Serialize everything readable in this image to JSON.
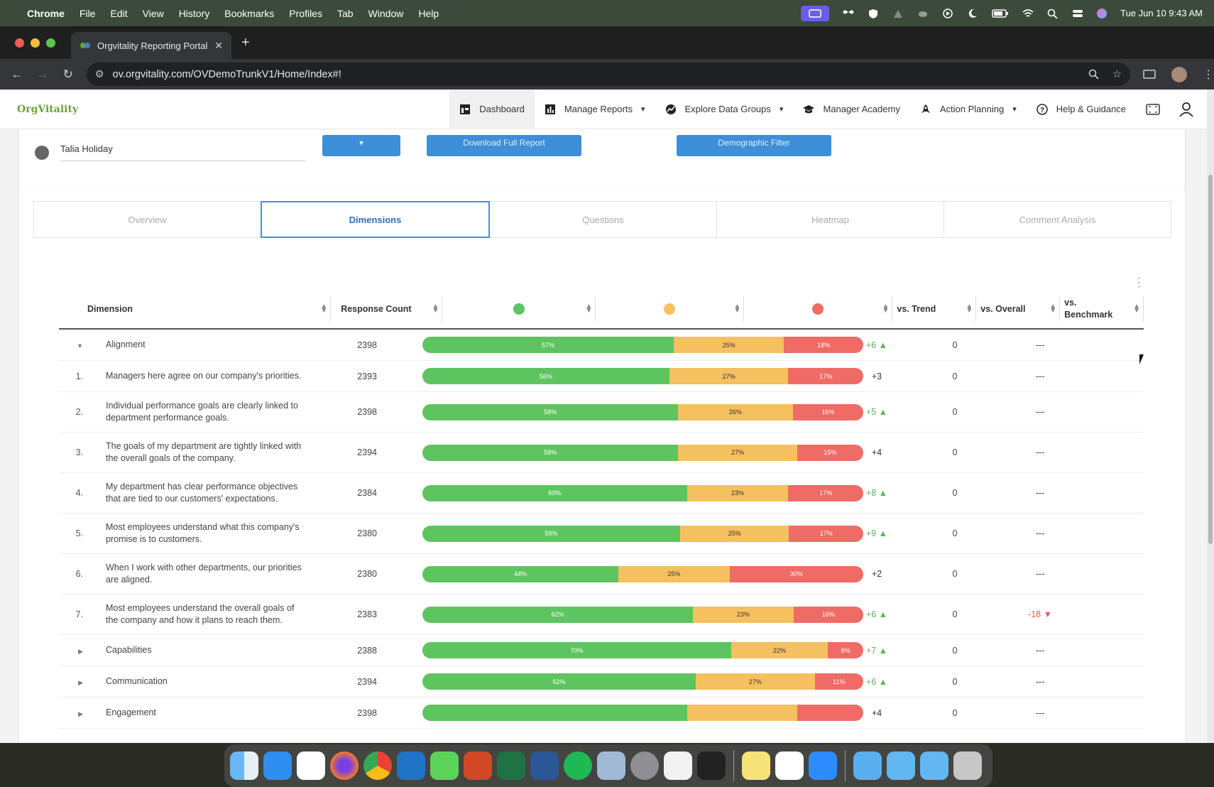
{
  "menubar": {
    "app": "Chrome",
    "items": [
      "File",
      "Edit",
      "View",
      "History",
      "Bookmarks",
      "Profiles",
      "Tab",
      "Window",
      "Help"
    ],
    "datetime": "Tue Jun 10  9:43 AM"
  },
  "browser": {
    "tab_title": "Orgvitality Reporting Portal",
    "url": "ov.orgvitality.com/OVDemoTrunkV1/Home/Index#!"
  },
  "app": {
    "logo_prefix": "Org",
    "logo_suffix": "Vitality",
    "nav": [
      {
        "label": "Dashboard",
        "icon": "dashboard-icon"
      },
      {
        "label": "Manage Reports",
        "icon": "bar-chart-icon"
      },
      {
        "label": "Explore Data Groups",
        "icon": "explore-chart-icon"
      },
      {
        "label": "Manager Academy",
        "icon": "graduation-cap-icon"
      },
      {
        "label": "Action Planning",
        "icon": "rocket-icon"
      },
      {
        "label": "Help & Guidance",
        "icon": "help-circle-icon"
      }
    ]
  },
  "filters": {
    "user_name": "Talia Holiday",
    "download_label": "Download Full Report",
    "demographic_label": "Demographic Filter"
  },
  "tabs": [
    "Overview",
    "Dimensions",
    "Questions",
    "Heatmap",
    "Comment Analysis"
  ],
  "active_tab": "Dimensions",
  "table": {
    "headers": {
      "dimension": "Dimension",
      "response_count": "Response Count",
      "favorable_color": "#5ec460",
      "neutral_color": "#f5c05f",
      "unfavorable_color": "#ee6b66",
      "vs_trend": "vs. Trend",
      "vs_overall": "vs. Overall",
      "vs_benchmark": "vs. Benchmark"
    },
    "rows": [
      {
        "type": "group",
        "expanded": true,
        "index": "",
        "label": "Alignment",
        "count": "2398",
        "fav": 57,
        "neu": 25,
        "unf": 18,
        "fav_label": "57%",
        "neu_label": "25%",
        "unf_label": "18%",
        "trend": "+6 ▲",
        "trend_class": "pos",
        "overall": "0",
        "bench": "---",
        "bench_class": "neu"
      },
      {
        "type": "item",
        "index": "1.",
        "label": "Managers here agree on our company's priorities.",
        "count": "2393",
        "fav": 56,
        "neu": 27,
        "unf": 17,
        "fav_label": "56%",
        "neu_label": "27%",
        "unf_label": "17%",
        "trend": "+3",
        "trend_class": "neu",
        "overall": "0",
        "bench": "---",
        "bench_class": "neu"
      },
      {
        "type": "item",
        "index": "2.",
        "label": "Individual performance goals are clearly linked to department performance goals.",
        "count": "2398",
        "fav": 58,
        "neu": 26,
        "unf": 16,
        "fav_label": "58%",
        "neu_label": "26%",
        "unf_label": "16%",
        "trend": "+5 ▲",
        "trend_class": "pos",
        "overall": "0",
        "bench": "---",
        "bench_class": "neu"
      },
      {
        "type": "item",
        "index": "3.",
        "label": "The goals of my department are tightly linked with the overall goals of the company.",
        "count": "2394",
        "fav": 58,
        "neu": 27,
        "unf": 15,
        "fav_label": "58%",
        "neu_label": "27%",
        "unf_label": "15%",
        "trend": "+4",
        "trend_class": "neu",
        "overall": "0",
        "bench": "---",
        "bench_class": "neu"
      },
      {
        "type": "item",
        "index": "4.",
        "label": "My department has clear performance objectives that are tied to our customers' expectations.",
        "count": "2384",
        "fav": 60,
        "neu": 23,
        "unf": 17,
        "fav_label": "60%",
        "neu_label": "23%",
        "unf_label": "17%",
        "trend": "+8 ▲",
        "trend_class": "pos",
        "overall": "0",
        "bench": "---",
        "bench_class": "neu"
      },
      {
        "type": "item",
        "index": "5.",
        "label": "Most employees understand what this company's promise is to customers.",
        "count": "2380",
        "fav": 59,
        "neu": 25,
        "unf": 17,
        "fav_label": "59%",
        "neu_label": "25%",
        "unf_label": "17%",
        "trend": "+9 ▲",
        "trend_class": "pos",
        "overall": "0",
        "bench": "---",
        "bench_class": "neu"
      },
      {
        "type": "item",
        "index": "6.",
        "label": "When I work with other departments, our priorities are aligned.",
        "count": "2380",
        "fav": 44,
        "neu": 25,
        "unf": 30,
        "fav_label": "44%",
        "neu_label": "25%",
        "unf_label": "30%",
        "trend": "+2",
        "trend_class": "neu",
        "overall": "0",
        "bench": "---",
        "bench_class": "neu"
      },
      {
        "type": "item",
        "index": "7.",
        "label": "Most employees understand the overall goals of the company and how it plans to reach them.",
        "count": "2383",
        "fav": 62,
        "neu": 23,
        "unf": 16,
        "fav_label": "62%",
        "neu_label": "23%",
        "unf_label": "16%",
        "trend": "+6 ▲",
        "trend_class": "pos",
        "overall": "0",
        "bench": "-18 ▼",
        "bench_class": "neg"
      },
      {
        "type": "group",
        "expanded": false,
        "index": "",
        "label": "Capabilities",
        "count": "2388",
        "fav": 70,
        "neu": 22,
        "unf": 8,
        "fav_label": "70%",
        "neu_label": "22%",
        "unf_label": "8%",
        "trend": "+7 ▲",
        "trend_class": "pos",
        "overall": "0",
        "bench": "---",
        "bench_class": "neu"
      },
      {
        "type": "group",
        "expanded": false,
        "index": "",
        "label": "Communication",
        "count": "2394",
        "fav": 62,
        "neu": 27,
        "unf": 11,
        "fav_label": "62%",
        "neu_label": "27%",
        "unf_label": "11%",
        "trend": "+6 ▲",
        "trend_class": "pos",
        "overall": "0",
        "bench": "---",
        "bench_class": "neu"
      },
      {
        "type": "group",
        "expanded": false,
        "index": "",
        "label": "Engagement",
        "count": "2398",
        "fav": 60,
        "neu": 25,
        "unf": 15,
        "fav_label": "",
        "neu_label": "",
        "unf_label": "",
        "trend": "+4",
        "trend_class": "neu",
        "overall": "0",
        "bench": "---",
        "bench_class": "neu"
      }
    ]
  }
}
